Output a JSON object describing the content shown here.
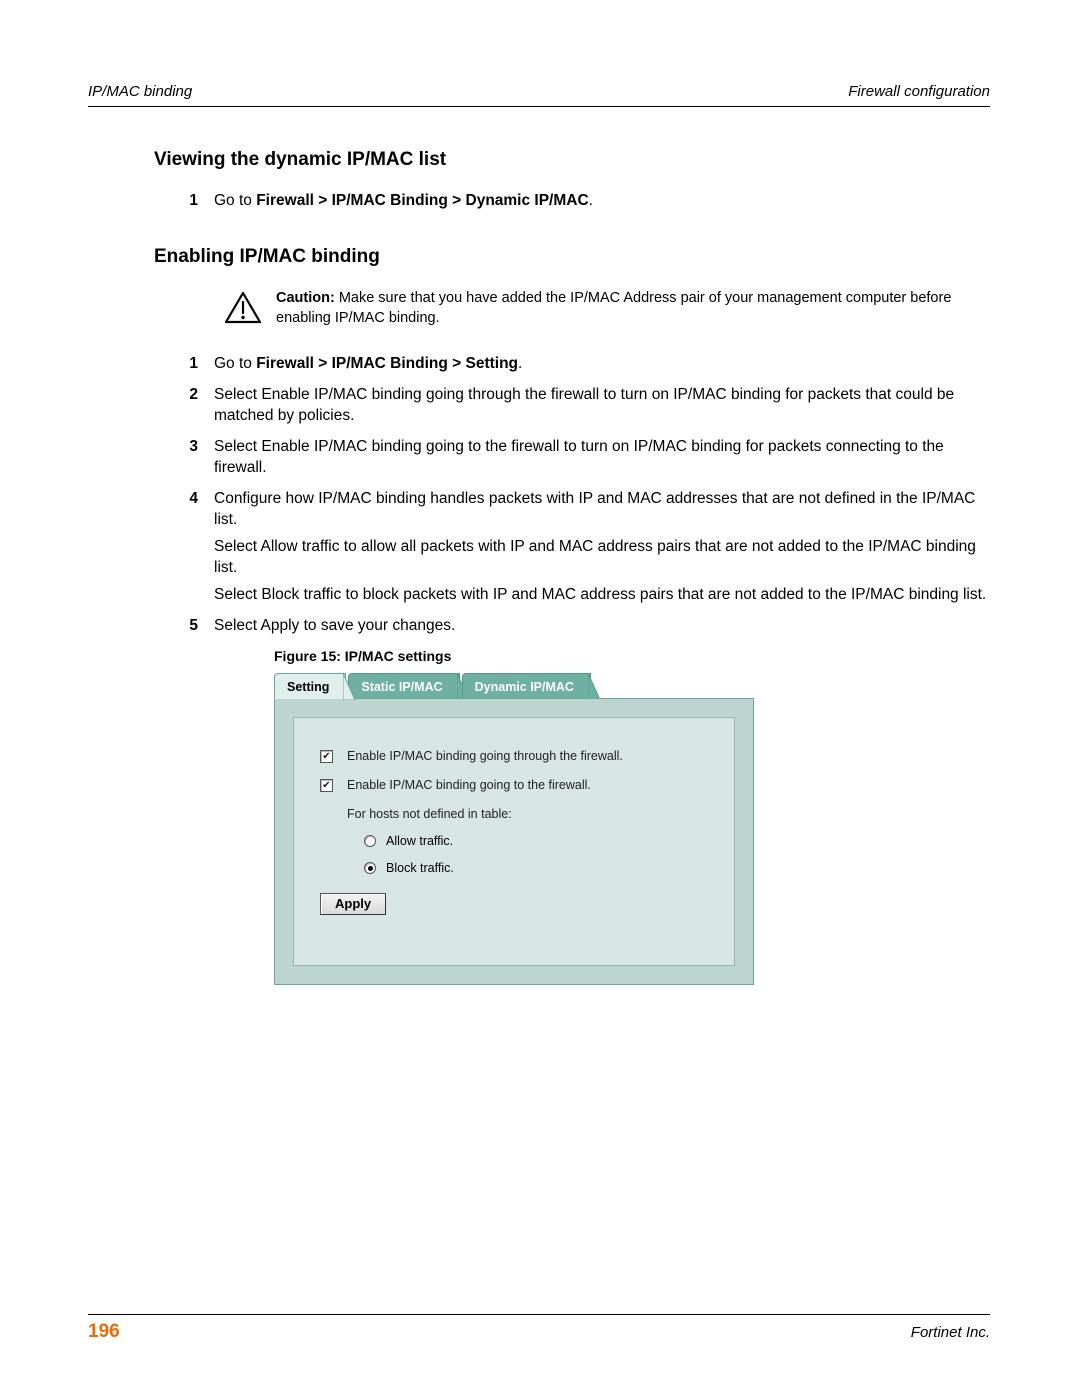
{
  "header": {
    "left": "IP/MAC binding",
    "right": "Firewall configuration"
  },
  "section1": {
    "title": "Viewing the dynamic IP/MAC list",
    "steps": [
      {
        "num": "1",
        "text_prefix": "Go to ",
        "bold": "Firewall > IP/MAC Binding > Dynamic IP/MAC",
        "text_suffix": "."
      }
    ]
  },
  "section2": {
    "title": "Enabling IP/MAC binding",
    "caution": {
      "label": "Caution:",
      "text": " Make sure that you have added the IP/MAC Address pair of your management computer before enabling IP/MAC binding."
    },
    "steps": [
      {
        "num": "1",
        "paras": [
          {
            "prefix": "Go to ",
            "bold": "Firewall > IP/MAC Binding > Setting",
            "suffix": "."
          }
        ]
      },
      {
        "num": "2",
        "paras": [
          {
            "text": "Select Enable IP/MAC binding going through the firewall to turn on IP/MAC binding for packets that could be matched by policies."
          }
        ]
      },
      {
        "num": "3",
        "paras": [
          {
            "text": "Select Enable IP/MAC binding going to the firewall to turn on IP/MAC binding for packets connecting to the firewall."
          }
        ]
      },
      {
        "num": "4",
        "paras": [
          {
            "text": "Configure how IP/MAC binding handles packets with IP and MAC addresses that are not defined in the IP/MAC list."
          },
          {
            "text": "Select Allow traffic to allow all packets with IP and MAC address pairs that are not added to the IP/MAC binding list."
          },
          {
            "text": "Select Block traffic to block packets with IP and MAC address pairs that are not added to the IP/MAC binding list."
          }
        ]
      },
      {
        "num": "5",
        "paras": [
          {
            "text": "Select Apply to save your changes."
          }
        ]
      }
    ]
  },
  "figure": {
    "caption": "Figure 15: IP/MAC settings",
    "ui": {
      "tabs": [
        "Setting",
        "Static IP/MAC",
        "Dynamic IP/MAC"
      ],
      "checkbox1": "Enable IP/MAC binding going through the firewall.",
      "checkbox2": "Enable IP/MAC binding going to the firewall.",
      "sublabel": "For hosts not defined in table:",
      "radio_allow": "Allow traffic.",
      "radio_block": "Block traffic.",
      "apply": "Apply"
    }
  },
  "footer": {
    "page": "196",
    "right": "Fortinet Inc."
  }
}
